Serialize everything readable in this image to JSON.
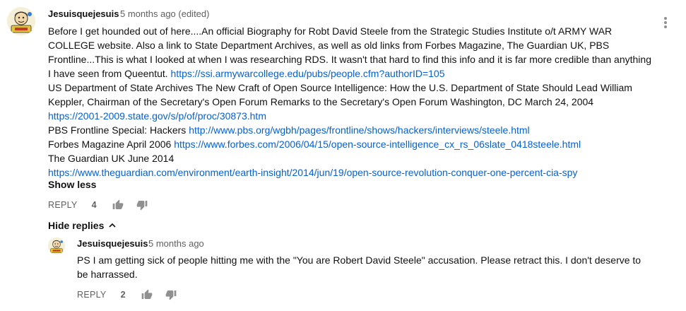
{
  "comment": {
    "author": "Jesuisquejesuis",
    "time": "5 months ago (edited)",
    "lines": [
      {
        "text": "Before I get hounded out of here....An official Biography for Robt David Steele from the Strategic Studies Institute o/t ARMY WAR",
        "link": ""
      },
      {
        "text": "COLLEGE website.  Also a link to State Department Archives, as well as old links from Forbes Magazine, The Guardian UK, PBS",
        "link": ""
      },
      {
        "text": "Frontline...This is what I looked at when I was researching RDS.  It wasn't that hard to find this info and it is far more credible than anything",
        "link": ""
      },
      {
        "text": "I have seen from Queentut.   ",
        "link": "https://ssi.armywarcollege.edu/pubs/people.cfm?authorID=105"
      },
      {
        "text": "US Department of State Archives The New Craft of Open Source Intelligence: How the U.S. Department of State Should Lead William",
        "link": ""
      },
      {
        "text": "Keppler, Chairman of the Secretary's Open Forum Remarks to the Secretary's Open Forum Washington, DC  March 24, 2004",
        "link": ""
      },
      {
        "text": "",
        "link": "https://2001-2009.state.gov/s/p/of/proc/30873.htm"
      },
      {
        "text": "PBS Frontline Special: Hackers ",
        "link": "http://www.pbs.org/wgbh/pages/frontline/shows/hackers/interviews/steele.html"
      },
      {
        "text": "Forbes Magazine April 2006 ",
        "link": "https://www.forbes.com/2006/04/15/open-source-intelligence_cx_rs_06slate_0418steele.html"
      },
      {
        "text": "The Guardian UK June 2014",
        "link": ""
      },
      {
        "text": "",
        "link": "https://www.theguardian.com/environment/earth-insight/2014/jun/19/open-source-revolution-conquer-one-percent-cia-spy"
      }
    ],
    "show_less": "Show less",
    "reply_label": "REPLY",
    "like_count": "4"
  },
  "hide_replies": "Hide replies",
  "reply": {
    "author": "Jesuisquejesuis",
    "time": "5 months ago",
    "lines": [
      "PS  I am getting sick of people hitting me with the \"You are Robert David Steele\" accusation.  Please retract this.  I don't deserve to",
      "be harrassed."
    ],
    "reply_label": "REPLY",
    "like_count": "2"
  },
  "icons": {
    "avatar": "cartoon-avatar-icon",
    "like": "thumbs-up-icon",
    "dislike": "thumbs-down-icon",
    "menu": "more-vert-icon",
    "chevron": "chevron-up-icon"
  },
  "colors": {
    "link": "#065fd4",
    "meta": "#606060",
    "text": "#111111"
  }
}
